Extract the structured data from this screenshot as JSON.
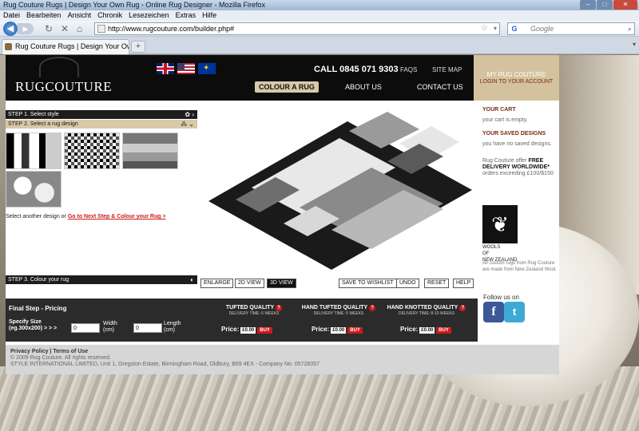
{
  "browser": {
    "window_title": "Rug Couture Rugs | Design Your Own Rug - Online Rug Designer - Mozilla Firefox",
    "menu": [
      "Datei",
      "Bearbeiten",
      "Ansicht",
      "Chronik",
      "Lesezeichen",
      "Extras",
      "Hilfe"
    ],
    "url": "http://www.rugcouture.com/builder.php#",
    "search_placeholder": "Google",
    "tab_title": "Rug Couture Rugs | Design Your Own..."
  },
  "header": {
    "logo": "RUGCOUTURE",
    "call": "CALL 0845 071 9303",
    "faqs": "FAQS",
    "sitemap": "SITE MAP",
    "colour_a_rug": "COLOUR A RUG",
    "about_us": "ABOUT US",
    "contact_us": "CONTACT US",
    "my_rug_couture": "MY RUG COUTURE",
    "login": "LOGIN TO YOUR ACCOUNT"
  },
  "steps": {
    "step1": "STEP 1. Select style",
    "step2": "STEP 2. Select a rug design",
    "step3": "STEP 3. Colour your rug",
    "another_design": "Select another design or ",
    "next_step": "Go to Next Step & Colour your Rug >"
  },
  "view_buttons": {
    "enlarge": "ENLARGE",
    "view2d": "2D VIEW",
    "view3d": "3D VIEW",
    "wishlist": "SAVE TO WISHLIST",
    "undo": "UNDO",
    "reset": "RESET",
    "help": "HELP"
  },
  "right_panel": {
    "cart_title": "YOUR CART",
    "cart_text": "your cart is empty.",
    "saved_title": "YOUR SAVED DESIGNS",
    "saved_text": "you have no saved designs.",
    "delivery_prefix": "Rug Couture offer ",
    "delivery_bold": "FREE DELIVERY WORLDWIDE*",
    "delivery_note": "orders exceeding £100/$150",
    "wools_line1": "WOOLS",
    "wools_line2": "OF",
    "wools_line3": "NEW ZEALAND",
    "wools_desc": "All custom rugs from Rug Couture are made from New Zealand Wool.",
    "follow": "Follow us on"
  },
  "pricing": {
    "final_step": "Final Step - Pricing",
    "specify_size": "Specify Size",
    "specify_example": "(eg.300x200) > > >",
    "width_value": "0",
    "width_label": "Width",
    "width_unit": "(cm)",
    "length_value": "0",
    "length_label": "Length",
    "length_unit": "(cm)",
    "qualities": [
      {
        "name": "TUFTED QUALITY",
        "time": "DELIVERY TIME: 6 WEEKS"
      },
      {
        "name": "HAND TUFTED QUALITY",
        "time": "DELIVERY TIME: 6 WEEKS"
      },
      {
        "name": "HAND KNOTTED QUALITY",
        "time": "DELIVERY TIME: 8-10 WEEKS"
      }
    ],
    "price_label": "Price:",
    "price_value": "£0.00",
    "buy": "BUY"
  },
  "footer": {
    "privacy": "Privacy Policy",
    "terms": "Terms of Use",
    "copyright": "© 2009 Rug Couture. All rights reserved.",
    "company": "STYLE INTERNATIONAL LIMITED, Unit 1, Gregston Estate, Birmingham Road, Oldbury, B69 4EX - Company No. 05728357"
  },
  "colors": {
    "accent_gold": "#d3c29d",
    "accent_red": "#cc1a1a",
    "dark": "#0c0c0c"
  }
}
